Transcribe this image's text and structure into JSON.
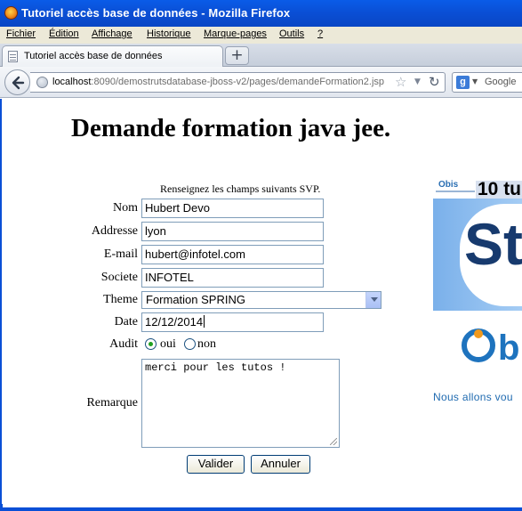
{
  "window": {
    "title": "Tutoriel accès base de données - Mozilla Firefox"
  },
  "menu": [
    "Fichier",
    "Édition",
    "Affichage",
    "Historique",
    "Marque-pages",
    "Outils",
    "?"
  ],
  "tab": {
    "label": "Tutoriel accès base de données",
    "new_tab": "+"
  },
  "nav": {
    "url_host": "localhost",
    "url_rest": ":8090/demostrutsdatabase-jboss-v2/pages/demandeFormation2.jsp",
    "search_placeholder": "Google",
    "search_engine_letter": "g"
  },
  "page": {
    "heading": "Demande formation java jee.",
    "instructions": "Renseignez les champs suivants SVP."
  },
  "form": {
    "nom_label": "Nom",
    "nom_value": "Hubert Devo",
    "addresse_label": "Addresse",
    "addresse_value": "lyon",
    "email_label": "E-mail",
    "email_value": "hubert@infotel.com",
    "societe_label": "Societe",
    "societe_value": "INFOTEL",
    "theme_label": "Theme",
    "theme_value": "Formation SPRING",
    "date_label": "Date",
    "date_value": "12/12/2014",
    "audit_label": "Audit",
    "audit_oui": "oui",
    "audit_non": "non",
    "audit_selected": "oui",
    "remarque_label": "Remarque",
    "remarque_value": "merci pour les tutos !",
    "submit_label": "Valider",
    "cancel_label": "Annuler"
  },
  "ads": {
    "banner_brand": "Obis",
    "banner_number": "10 tu",
    "banner_word": "Str",
    "logo_text": "b",
    "slogan": "Nous allons vou"
  },
  "colors": {
    "titlebar": "#0a4fd6",
    "link_blue": "#1f6ab0",
    "radio_green": "#21a121"
  }
}
